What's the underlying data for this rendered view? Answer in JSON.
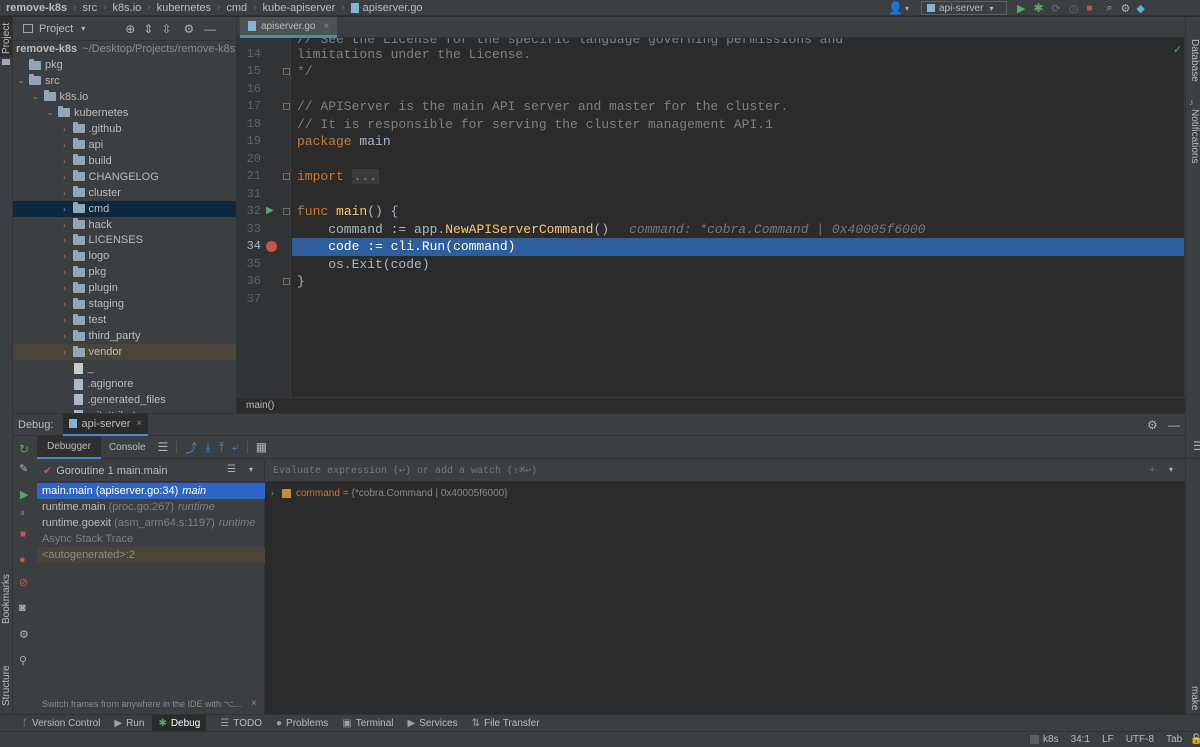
{
  "nav": {
    "crumbs": [
      "remove-k8s",
      "src",
      "k8s.io",
      "kubernetes",
      "cmd",
      "kube-apiserver",
      "apiserver.go"
    ],
    "run_config": "api-server"
  },
  "left_stripe": {
    "project": "Project",
    "bookmarks": "Bookmarks",
    "structure": "Structure"
  },
  "right_stripe": {
    "database": "Database",
    "notifications": "Notifications",
    "make": "make"
  },
  "project_panel": {
    "title": "Project",
    "root": "remove-k8s",
    "root_path": "~/Desktop/Projects/remove-k8s",
    "items": [
      {
        "label": "pkg",
        "kind": "folder",
        "depth": 0,
        "expand": "none"
      },
      {
        "label": "src",
        "kind": "folder",
        "depth": 0,
        "expand": "open"
      },
      {
        "label": "k8s.io",
        "kind": "folder",
        "depth": 1,
        "expand": "open"
      },
      {
        "label": "kubernetes",
        "kind": "folder",
        "depth": 2,
        "expand": "open"
      },
      {
        "label": ".github",
        "kind": "folder",
        "depth": 3,
        "expand": "closed"
      },
      {
        "label": "api",
        "kind": "folder",
        "depth": 3,
        "expand": "closed"
      },
      {
        "label": "build",
        "kind": "folder",
        "depth": 3,
        "expand": "closed"
      },
      {
        "label": "CHANGELOG",
        "kind": "folder",
        "depth": 3,
        "expand": "closed"
      },
      {
        "label": "cluster",
        "kind": "folder",
        "depth": 3,
        "expand": "closed"
      },
      {
        "label": "cmd",
        "kind": "folder",
        "depth": 3,
        "expand": "closed",
        "selected": true
      },
      {
        "label": "hack",
        "kind": "folder",
        "depth": 3,
        "expand": "closed"
      },
      {
        "label": "LICENSES",
        "kind": "folder",
        "depth": 3,
        "expand": "closed"
      },
      {
        "label": "logo",
        "kind": "folder",
        "depth": 3,
        "expand": "closed"
      },
      {
        "label": "pkg",
        "kind": "folder",
        "depth": 3,
        "expand": "closed"
      },
      {
        "label": "plugin",
        "kind": "folder",
        "depth": 3,
        "expand": "closed"
      },
      {
        "label": "staging",
        "kind": "folder",
        "depth": 3,
        "expand": "closed"
      },
      {
        "label": "test",
        "kind": "folder",
        "depth": 3,
        "expand": "closed"
      },
      {
        "label": "third_party",
        "kind": "folder",
        "depth": 3,
        "expand": "closed"
      },
      {
        "label": "vendor",
        "kind": "folder",
        "depth": 3,
        "expand": "closed",
        "vendor": true
      },
      {
        "label": "_",
        "kind": "file",
        "depth": 3,
        "expand": "none"
      },
      {
        "label": ".agignore",
        "kind": "file",
        "depth": 3,
        "expand": "none"
      },
      {
        "label": ".generated_files",
        "kind": "file",
        "depth": 3,
        "expand": "none"
      },
      {
        "label": ".gitattributes",
        "kind": "file",
        "depth": 3,
        "expand": "none"
      }
    ]
  },
  "editor": {
    "tab": "apiserver.go",
    "bottom_crumb": "main()",
    "line_numbers": [
      "14",
      "15",
      "16",
      "17",
      "18",
      "19",
      "20",
      "21",
      "31",
      "32",
      "33",
      "34",
      "35",
      "36",
      "37"
    ],
    "lines": {
      "l13": "// See the License for the specific language governing permissions and",
      "l14": "limitations under the License.",
      "l15": "*/",
      "l17": "// APIServer is the main API server and master for the cluster.",
      "l18": "// It is responsible for serving the cluster management API.1",
      "l19_kw": "package",
      "l19_rest": " main",
      "l21_kw": "import",
      "l21_fold": "...",
      "l32_kw": "func",
      "l32_fn": "main",
      "l32_rest": "() {",
      "l33_a": "    command := ",
      "l33_b": "app.",
      "l33_fn": "NewAPIServerCommand",
      "l33_c": "()",
      "l33_hint": "command: *cobra.Command | 0x40005f6000",
      "l34": "    code := cli.Run(command)",
      "l35": "    os.Exit(code)",
      "l36": "}"
    }
  },
  "debug": {
    "label": "Debug:",
    "session": "api-server",
    "tabs": [
      "Debugger",
      "Console"
    ],
    "goroutine": "Goroutine 1 main.main",
    "frames": [
      {
        "fn": "main.main",
        "loc": "(apiserver.go:34)",
        "pkg": "main",
        "selected": true
      },
      {
        "fn": "runtime.main",
        "loc": "(proc.go:267)",
        "pkg": "runtime"
      },
      {
        "fn": "runtime.goexit",
        "loc": "(asm_arm64.s:1197)",
        "pkg": "runtime"
      }
    ],
    "async_label": "Async Stack Trace",
    "async_frame": "<autogenerated>:2",
    "hint": "Switch frames from anywhere in the IDE with ⌥...",
    "eval_placeholder": "Evaluate expression (↩) or add a watch (⇧⌘↩)",
    "var_name": "command",
    "var_value": "= {*cobra.Command | 0x40005f6000}"
  },
  "bottom_tools": [
    "Version Control",
    "Run",
    "Debug",
    "TODO",
    "Problems",
    "Terminal",
    "Services",
    "File Transfer"
  ],
  "status": {
    "project": "k8s",
    "pos": "34:1",
    "eol": "LF",
    "enc": "UTF-8",
    "indent": "Tab"
  },
  "colors": {
    "selection": "#2d5f9e",
    "frame_selected": "#2f65ca",
    "keyword": "#cc7832",
    "function": "#ffc66d",
    "breakpoint": "#c75450"
  }
}
